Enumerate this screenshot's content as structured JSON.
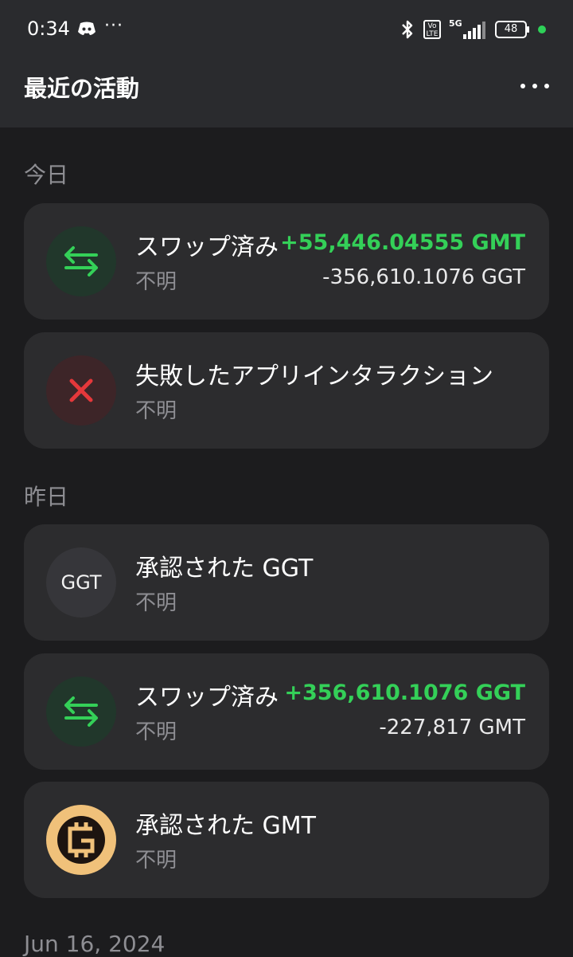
{
  "status_bar": {
    "time": "0:34",
    "more": "···",
    "volte": [
      "Vo",
      "LTE"
    ],
    "network": "5G",
    "battery": "48"
  },
  "header": {
    "title": "最近の活動"
  },
  "sections": [
    {
      "label": "今日",
      "items": [
        {
          "title": "スワップ済み",
          "subtitle": "不明",
          "amount_in": "+55,446.04555 GMT",
          "amount_out": "-356,610.1076 GGT",
          "icon": "swap-arrows-icon"
        },
        {
          "title": "失敗したアプリインタラクション",
          "subtitle": "不明",
          "icon": "close-icon"
        }
      ]
    },
    {
      "label": "昨日",
      "items": [
        {
          "title": "承認された GGT",
          "subtitle": "不明",
          "icon_text": "GGT"
        },
        {
          "title": "スワップ済み",
          "subtitle": "不明",
          "amount_in": "+356,610.1076 GGT",
          "amount_out": "-227,817 GMT",
          "icon": "swap-arrows-icon"
        },
        {
          "title": "承認された GMT",
          "subtitle": "不明",
          "icon": "gmt-token-icon"
        }
      ]
    },
    {
      "label": "Jun 16, 2024",
      "items": []
    }
  ],
  "colors": {
    "background": "#1c1c1e",
    "card": "#2c2c2e",
    "positive": "#34d058",
    "error": "#e5383b",
    "muted": "#8e8e93"
  }
}
